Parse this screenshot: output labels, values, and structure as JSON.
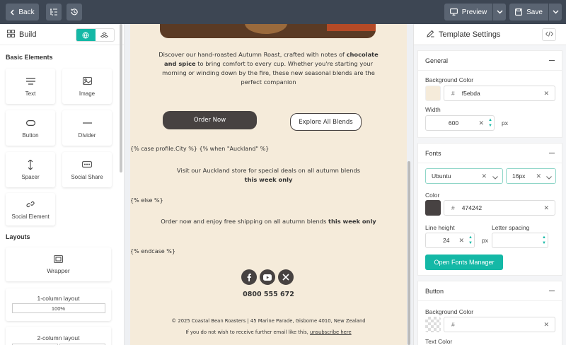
{
  "topbar": {
    "back_label": "Back",
    "preview_label": "Preview",
    "save_label": "Save",
    "icons": [
      "chevron-left-icon",
      "outline-icon",
      "history-icon",
      "monitor-icon",
      "chevron-down-icon",
      "save-icon"
    ]
  },
  "left_panel": {
    "title": "Build",
    "basic_elements_title": "Basic Elements",
    "elements": [
      {
        "label": "Text",
        "icon": "text-icon"
      },
      {
        "label": "Image",
        "icon": "image-icon"
      },
      {
        "label": "Button",
        "icon": "button-icon"
      },
      {
        "label": "Divider",
        "icon": "divider-icon"
      },
      {
        "label": "Spacer",
        "icon": "spacer-icon"
      },
      {
        "label": "Social Share",
        "icon": "social-share-icon"
      },
      {
        "label": "Social Element",
        "icon": "link-icon"
      }
    ],
    "layouts_title": "Layouts",
    "layouts": [
      {
        "label": "Wrapper"
      },
      {
        "label": "1-column layout",
        "bar": "100%"
      },
      {
        "label": "2-column layout"
      }
    ]
  },
  "email": {
    "intro_pre": "Discover our hand-roasted Autumn Roast, crafted with notes of",
    "intro_bold": "chocolate and spice",
    "intro_post": "to bring comfort to every cup. Whether you're starting your morning or winding down by the fire, these new seasonal blends are the perfect companion",
    "order_button": "Order Now",
    "explore_button": "Explore All Blends",
    "case_line": "{% case profile.City %} {% when \"Auckland\" %}",
    "auckland_text": "Visit our Auckland store for special deals on all autumn blends",
    "auckland_bold": "this week only",
    "else_line": "{% else %}",
    "else_text": "Order now and enjoy free shipping on all autumn blends",
    "else_bold": "this week only",
    "endcase_line": "{% endcase %}",
    "social_icons": [
      "facebook-icon",
      "youtube-icon",
      "x-icon"
    ],
    "phone": "0800 555 672",
    "footer_address": "© 2025 Coastal Bean Roasters | 45 Marine Parade, Gisborne 4010, New Zealand",
    "footer_unsub_pre": "If you do not wish to receive further email like this,",
    "footer_unsub_link": "unsubscribe here",
    "background_color": "#f5ebda",
    "button_color": "#474241"
  },
  "right_panel": {
    "title": "Template Settings",
    "general": {
      "title": "General",
      "bg_label": "Background Color",
      "bg_value": "f5ebda",
      "width_label": "Width",
      "width_value": "600",
      "width_unit": "px"
    },
    "fonts": {
      "title": "Fonts",
      "font_family": "Ubuntu",
      "font_size": "16px",
      "color_label": "Color",
      "color_value": "474242",
      "line_height_label": "Line height",
      "line_height_value": "24",
      "line_height_unit": "px",
      "letter_spacing_label": "Letter spacing",
      "letter_spacing_value": "",
      "manager_button": "Open Fonts Manager"
    },
    "button": {
      "title": "Button",
      "bg_label": "Background Color",
      "bg_value": "",
      "text_color_label": "Text Color"
    },
    "accent_color": "#14b8a6"
  }
}
